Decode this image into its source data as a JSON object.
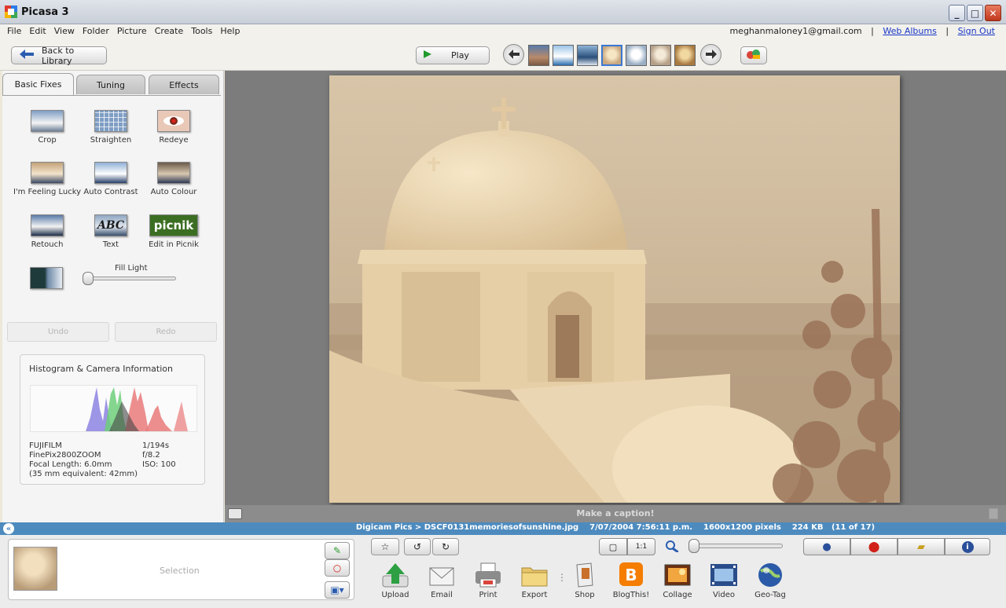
{
  "window": {
    "title": "Picasa 3"
  },
  "menu": {
    "items": [
      "File",
      "Edit",
      "View",
      "Folder",
      "Picture",
      "Create",
      "Tools",
      "Help"
    ],
    "account_email": "meghanmaloney1@gmail.com",
    "sep": "|",
    "web_albums": "Web Albums",
    "sign_out": "Sign Out"
  },
  "toolbar": {
    "back_label": "Back to Library",
    "play_label": "Play"
  },
  "edit_tabs": [
    "Basic Fixes",
    "Tuning",
    "Effects"
  ],
  "basic_fixes": {
    "tools": [
      "Crop",
      "Straighten",
      "Redeye",
      "I'm Feeling Lucky",
      "Auto Contrast",
      "Auto Colour",
      "Retouch",
      "Text",
      "Edit in Picnik"
    ],
    "fill_light_label": "Fill Light",
    "fill_light_value": 0,
    "undo_label": "Undo",
    "redo_label": "Redo",
    "abc_glyph": "ABC",
    "picnik_glyph": "picnik"
  },
  "histogram": {
    "title": "Histogram & Camera Information",
    "make": "FUJIFILM",
    "model": "FinePix2800ZOOM",
    "focal_length": "Focal Length: 6.0mm",
    "equivalent": "(35 mm equivalent:  42mm)",
    "shutter": "1/194s",
    "aperture": "f/8.2",
    "iso": "ISO: 100"
  },
  "caption_placeholder": "Make a caption!",
  "status": {
    "path": "Digicam Pics > DSCF0131memoriesofsunshine.jpg",
    "date": "7/07/2004 7:56:11 p.m.",
    "dimensions": "1600x1200 pixels",
    "size": "224 KB",
    "position": "(11 of 17)"
  },
  "tray": {
    "selection_label": "Selection"
  },
  "actions": [
    "Upload",
    "Email",
    "Print",
    "Export",
    "Shop",
    "BlogThis!",
    "Collage",
    "Video",
    "Geo-Tag"
  ],
  "zoom": {
    "fit_label": "1:1"
  },
  "icons": {
    "back": "left-arrow-icon",
    "play": "play-icon",
    "prev": "left-arrow-icon",
    "next": "right-arrow-icon"
  }
}
